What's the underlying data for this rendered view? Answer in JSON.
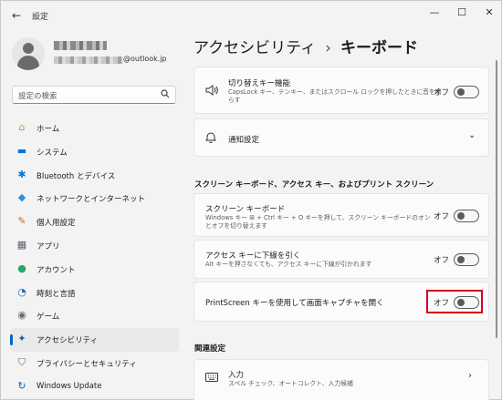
{
  "window": {
    "app_title": "設定",
    "controls": {
      "minimize": "—",
      "maximize": "☐",
      "close": "✕"
    },
    "back_label": "←"
  },
  "profile": {
    "email_suffix": "@outlook.jp"
  },
  "search": {
    "placeholder": "設定の検索"
  },
  "nav": {
    "items": [
      {
        "label": "ホーム",
        "icon": "home-icon",
        "glyph": "⌂",
        "color": "#d98c2b"
      },
      {
        "label": "システム",
        "icon": "system-icon",
        "glyph": "▬",
        "color": "#0078d4"
      },
      {
        "label": "Bluetooth とデバイス",
        "icon": "bluetooth-icon",
        "glyph": "✱",
        "color": "#0078d4"
      },
      {
        "label": "ネットワークとインターネット",
        "icon": "network-icon",
        "glyph": "◆",
        "color": "#2f8fd6"
      },
      {
        "label": "個人用設定",
        "icon": "personalization-icon",
        "glyph": "✎",
        "color": "#c56d2a"
      },
      {
        "label": "アプリ",
        "icon": "apps-icon",
        "glyph": "▦",
        "color": "#5a5f73"
      },
      {
        "label": "アカウント",
        "icon": "accounts-icon",
        "glyph": "●",
        "color": "#2aa56e"
      },
      {
        "label": "時刻と言語",
        "icon": "time-language-icon",
        "glyph": "◔",
        "color": "#1f6fc2"
      },
      {
        "label": "ゲーム",
        "icon": "gaming-icon",
        "glyph": "◉",
        "color": "#6b6b6b"
      },
      {
        "label": "アクセシビリティ",
        "icon": "accessibility-icon",
        "glyph": "✦",
        "color": "#1b5fa8",
        "active": true
      },
      {
        "label": "プライバシーとセキュリティ",
        "icon": "privacy-shield-icon",
        "glyph": "⛉",
        "color": "#6b6b6b"
      },
      {
        "label": "Windows Update",
        "icon": "windows-update-icon",
        "glyph": "↻",
        "color": "#0067c0"
      }
    ]
  },
  "main": {
    "breadcrumb_parent": "アクセシビリティ",
    "breadcrumb_sep": "›",
    "page_title": "キーボード",
    "toggle_keys": {
      "title": "切り替えキー機能",
      "desc": "CapsLock キー、テンキー、またはスクロール ロックを押したときに音を鳴らす",
      "state": "オフ"
    },
    "notifications": {
      "title": "通知設定",
      "chevron": "⌄"
    },
    "section_onscreen": "スクリーン キーボード、アクセス キー、およびプリント スクリーン",
    "onscreen_keyboard": {
      "title": "スクリーン キーボード",
      "desc": "Windows キー ⊞ + Ctrl キー + O キーを押して、スクリーン キーボードのオンとオフを切り替えます",
      "state": "オフ"
    },
    "underline_access_keys": {
      "title": "アクセス キーに下線を引く",
      "desc": "Alt キーを押さなくても、アクセス キーに下線が引かれます",
      "state": "オフ"
    },
    "printscreen": {
      "title": "PrintScreen キーを使用して画面キャプチャを開く",
      "state": "オフ"
    },
    "section_related": "関連設定",
    "input": {
      "title": "入力",
      "desc": "スペル チェック、オートコレクト、入力候補",
      "chevron": "›"
    }
  },
  "colors": {
    "accent": "#0067c0",
    "highlight": "#d5001c"
  }
}
